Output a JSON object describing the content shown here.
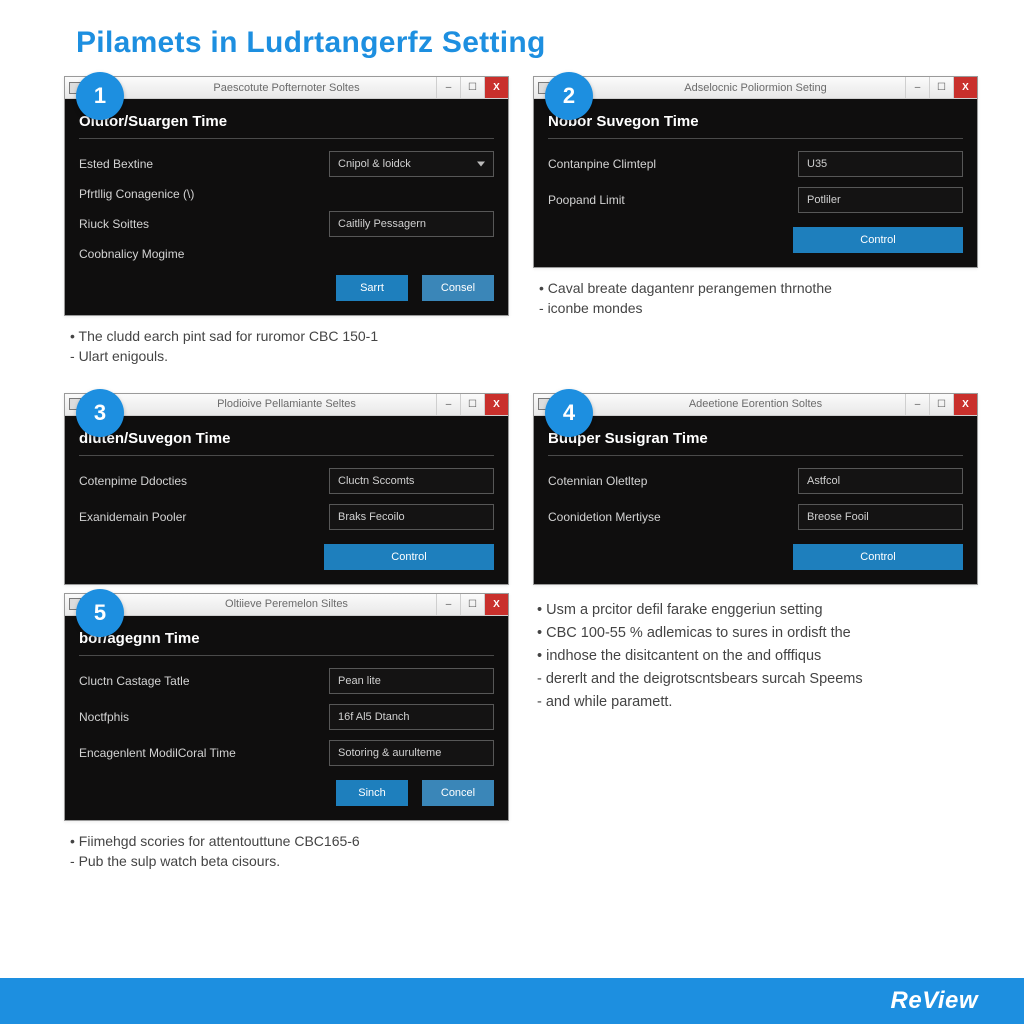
{
  "colors": {
    "accent": "#1d8fe0",
    "danger": "#c9302c"
  },
  "page": {
    "title": "Pilamets in Ludrtangerfz Setting"
  },
  "footer": {
    "logo": "ReView"
  },
  "steps": [
    {
      "badge": "1",
      "window_title": "Paescotute Pofternoter Soltes",
      "min": "–",
      "max": "☐",
      "close": "X",
      "section": "Olutor/Suargen Time",
      "rows": [
        {
          "label": "Ested Bextine",
          "value": "Cnipol & loidck",
          "dropdown": true,
          "tight": false
        },
        {
          "label": "Pfrtllig Conagenice (\\)",
          "value": "",
          "skip_field": true,
          "tight": true
        },
        {
          "label": "Riuck Soittes",
          "value": "Caitlily Pessagern",
          "tight": false
        },
        {
          "label": "Coobnalicy Mogime",
          "value": "",
          "skip_field": true,
          "tight": false
        }
      ],
      "buttons": [
        {
          "label": "Sarrt"
        },
        {
          "label": "Consel"
        }
      ],
      "button_mode": "pair",
      "caption": [
        {
          "style": "bullet",
          "text": "The cludd earch pint sad for ruromor CBC 150-1"
        },
        {
          "style": "dash",
          "text": "Ulart enigouls."
        }
      ]
    },
    {
      "badge": "2",
      "window_title": "Adselocnic Poliormion Seting",
      "min": "–",
      "max": "☐",
      "close": "X",
      "section": "Nobor Suvegon Time",
      "rows": [
        {
          "label": "Contanpine Climtepl",
          "value": "U35"
        },
        {
          "label": "Poopand Limit",
          "value": "Potliler"
        }
      ],
      "buttons": [
        {
          "label": "Control"
        }
      ],
      "button_mode": "wide",
      "caption": [
        {
          "style": "bullet",
          "text": "Caval breate dagantenr perangemen thrnothe"
        },
        {
          "style": "dash",
          "text": "iconbe mondes"
        }
      ]
    },
    {
      "badge": "3",
      "window_title": "Plodioive Pellamiante Seltes",
      "min": "–",
      "max": "☐",
      "close": "X",
      "section": "dluten/Suvegon Time",
      "rows": [
        {
          "label": "Cotenpime Ddocties",
          "value": "Cluctn Sccomts"
        },
        {
          "label": "Exanidemain Pooler",
          "value": "Braks Fecoilo"
        }
      ],
      "buttons": [
        {
          "label": "Control"
        }
      ],
      "button_mode": "wide",
      "caption": []
    },
    {
      "badge": "4",
      "window_title": "Adeetione Eorention Soltes",
      "min": "–",
      "max": "☐",
      "close": "X",
      "section": "Buuper Susigran Time",
      "rows": [
        {
          "label": "Cotennian Oletltep",
          "value": "Astfcol"
        },
        {
          "label": "Coonidetion Mertiyse",
          "value": "Breose Fooil"
        }
      ],
      "buttons": [
        {
          "label": "Control"
        }
      ],
      "button_mode": "wide",
      "caption": []
    },
    {
      "badge": "5",
      "window_title": "Oltiieve Peremelon Siltes",
      "min": "–",
      "max": "☐",
      "close": "X",
      "section": "bor/agegnn Time",
      "rows": [
        {
          "label": "Cluctn Castage Tatle",
          "value": "Pean lite"
        },
        {
          "label": "Noctfphis",
          "value": "16f Al5 Dtanch"
        },
        {
          "label": "Encagenlent ModilCoral Time",
          "value": "Sotoring & aurulteme"
        }
      ],
      "buttons": [
        {
          "label": "Sinch"
        },
        {
          "label": "Concel"
        }
      ],
      "button_mode": "pair",
      "caption": [
        {
          "style": "bullet",
          "text": "Fiimehgd scories for attentouttune CBC165-6"
        },
        {
          "style": "dash",
          "text": "Pub the sulp watch beta cisours."
        }
      ]
    }
  ],
  "side_notes": [
    {
      "style": "bullet",
      "text": "Usm a prcitor defil farake enggeriun setting"
    },
    {
      "style": "bullet",
      "text": "CBC 100-55 % adlemicas to sures in ordisft the"
    },
    {
      "style": "bullet",
      "text": "indhose the disitcantent on the and offfiqus"
    },
    {
      "style": "dash",
      "text": "dererlt and the deigrotscntsbears surcah Speems"
    },
    {
      "style": "dash",
      "text": "and while paramett."
    }
  ]
}
